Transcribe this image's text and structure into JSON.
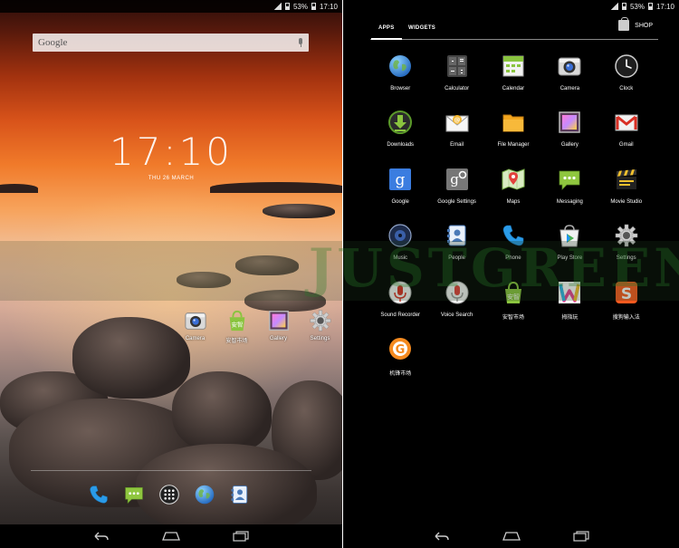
{
  "status": {
    "battery": "53%",
    "time": "17:10"
  },
  "home": {
    "search_label": "Google",
    "clock": "17:10",
    "date": "THU 26 MARCH",
    "icons": [
      {
        "label": "Camera",
        "icon": "camera-icon"
      },
      {
        "label": "安智市场",
        "icon": "anzhi-market-icon"
      },
      {
        "label": "Gallery",
        "icon": "gallery-icon"
      },
      {
        "label": "Settings",
        "icon": "settings-icon"
      }
    ],
    "dock": [
      {
        "icon": "phone-icon"
      },
      {
        "icon": "messaging-icon"
      },
      {
        "icon": "all-apps-icon"
      },
      {
        "icon": "browser-icon"
      },
      {
        "icon": "people-icon"
      }
    ]
  },
  "drawer": {
    "tabs": {
      "apps": "APPS",
      "widgets": "WIDGETS",
      "shop": "SHOP"
    },
    "apps": [
      {
        "label": "Browser",
        "icon": "browser-icon"
      },
      {
        "label": "Calculator",
        "icon": "calculator-icon"
      },
      {
        "label": "Calendar",
        "icon": "calendar-icon"
      },
      {
        "label": "Camera",
        "icon": "camera-icon"
      },
      {
        "label": "Clock",
        "icon": "clock-icon"
      },
      {
        "label": "Downloads",
        "icon": "downloads-icon"
      },
      {
        "label": "Email",
        "icon": "email-icon"
      },
      {
        "label": "File Manager",
        "icon": "file-manager-icon"
      },
      {
        "label": "Gallery",
        "icon": "gallery-icon"
      },
      {
        "label": "Gmail",
        "icon": "gmail-icon"
      },
      {
        "label": "Google",
        "icon": "google-icon"
      },
      {
        "label": "Google Settings",
        "icon": "google-settings-icon"
      },
      {
        "label": "Maps",
        "icon": "maps-icon"
      },
      {
        "label": "Messaging",
        "icon": "messaging-icon"
      },
      {
        "label": "Movie Studio",
        "icon": "movie-studio-icon"
      },
      {
        "label": "Music",
        "icon": "music-icon"
      },
      {
        "label": "People",
        "icon": "people-icon"
      },
      {
        "label": "Phone",
        "icon": "phone-icon"
      },
      {
        "label": "Play Store",
        "icon": "play-store-icon"
      },
      {
        "label": "Settings",
        "icon": "settings-icon"
      },
      {
        "label": "Sound Recorder",
        "icon": "sound-recorder-icon"
      },
      {
        "label": "Voice Search",
        "icon": "voice-search-icon"
      },
      {
        "label": "安智市场",
        "icon": "anzhi-market-icon"
      },
      {
        "label": "拇指玩",
        "icon": "muzhiwan-icon"
      },
      {
        "label": "搜狗输入法",
        "icon": "sogou-input-icon"
      },
      {
        "label": "机锋市场",
        "icon": "gfan-market-icon"
      }
    ]
  },
  "watermark": "JUSTGREEN"
}
